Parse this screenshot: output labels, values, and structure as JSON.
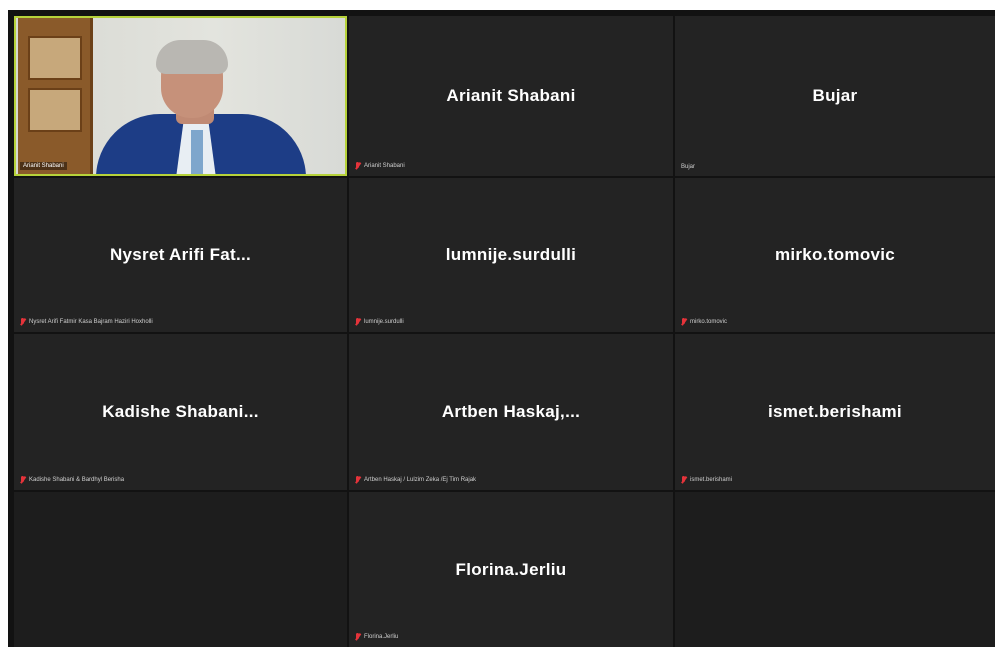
{
  "participants": [
    {
      "display_name": "",
      "label": "Arianit Shabani"
    },
    {
      "display_name": "Arianit Shabani",
      "label": "Arianit Shabani"
    },
    {
      "display_name": "Bujar",
      "label": "Bujar"
    },
    {
      "display_name": "Nysret Arifi Fat...",
      "label": "Nysret Arifi Fatmir Kasa Bajram Haziri Hoxholli"
    },
    {
      "display_name": "lumnije.surdulli",
      "label": "lumnije.surdulli"
    },
    {
      "display_name": "mirko.tomovic",
      "label": "mirko.tomovic"
    },
    {
      "display_name": "Kadishe Shabani...",
      "label": "Kadishe Shabani & Bardhyl Berisha"
    },
    {
      "display_name": "Artben Haskaj,...",
      "label": "Artben Haskaj / Lulzim Zeka /Ej Tim Rajak"
    },
    {
      "display_name": "ismet.berishami",
      "label": "ismet.berishami"
    },
    {
      "display_name": "Florina.Jerliu",
      "label": "Florina.Jerliu"
    }
  ],
  "colors": {
    "active_speaker_border": "#b6d23a",
    "muted_icon": "#e5333a",
    "tile_bg": "#232323"
  }
}
